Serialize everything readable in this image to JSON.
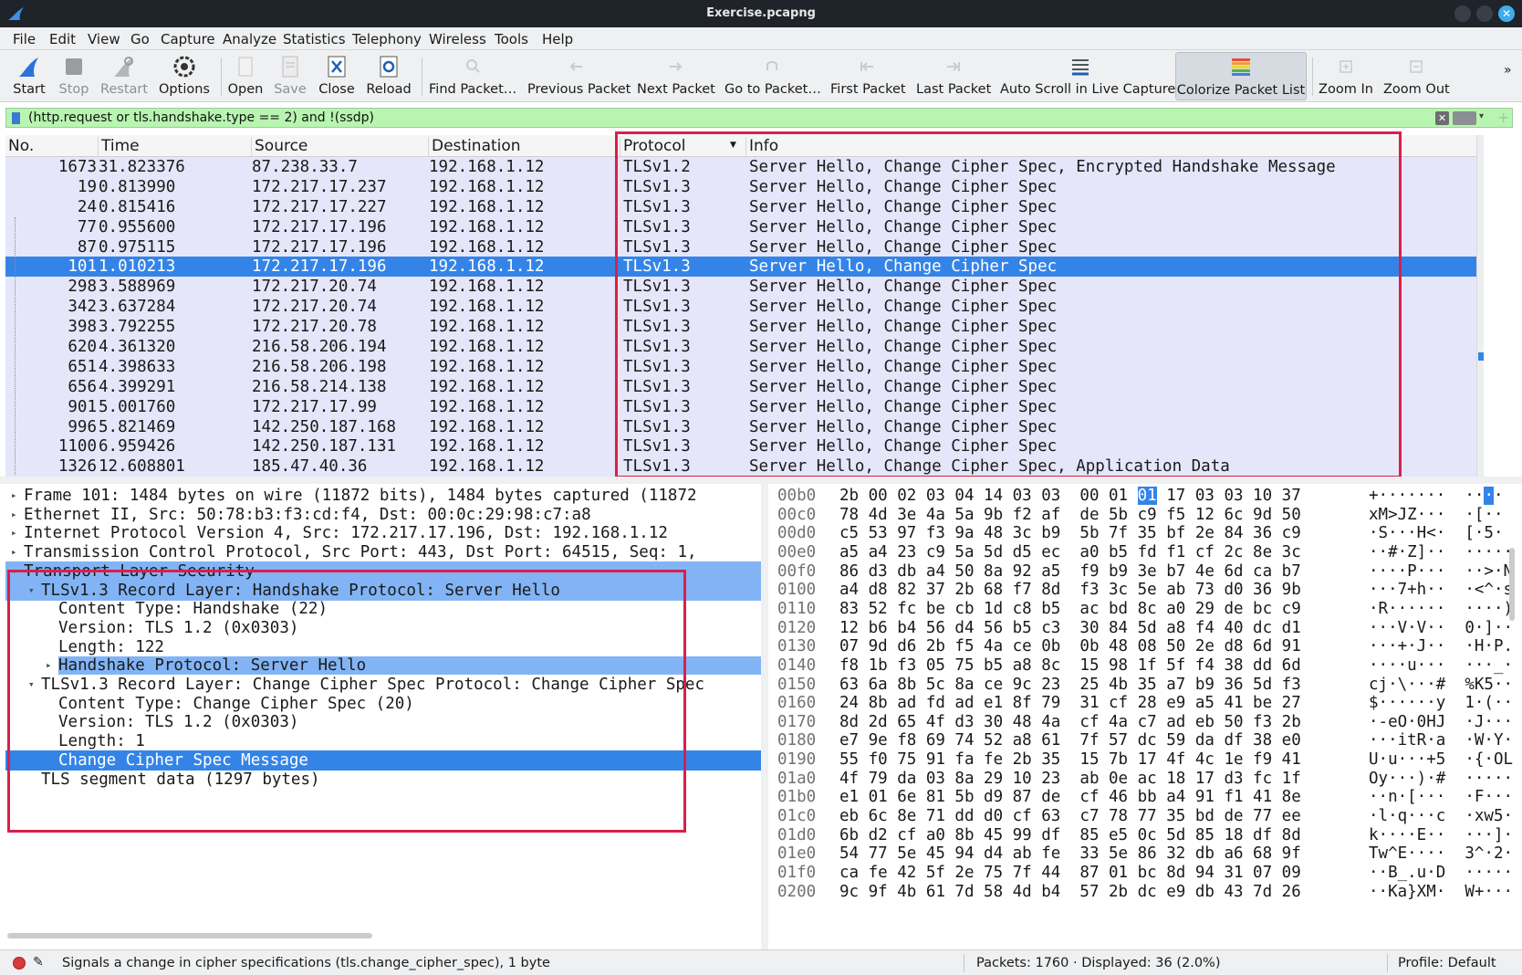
{
  "window": {
    "title": "Exercise.pcapng"
  },
  "menu": [
    "File",
    "Edit",
    "View",
    "Go",
    "Capture",
    "Analyze",
    "Statistics",
    "Telephony",
    "Wireless",
    "Tools",
    "Help"
  ],
  "toolbar": {
    "start": "Start",
    "stop": "Stop",
    "restart": "Restart",
    "options": "Options",
    "open": "Open",
    "save": "Save",
    "close": "Close",
    "reload": "Reload",
    "find_packet": "Find Packet…",
    "previous_packet": "Previous Packet",
    "next_packet": "Next Packet",
    "go_to_packet": "Go to Packet…",
    "first_packet": "First Packet",
    "last_packet": "Last Packet",
    "auto_scroll": "Auto Scroll in Live Capture",
    "colorize": "Colorize Packet List",
    "zoom_in": "Zoom In",
    "zoom_out": "Zoom Out",
    "more": "»"
  },
  "filter": {
    "value": "(http.request or tls.handshake.type == 2) and !(ssdp)"
  },
  "packet_list": {
    "columns": [
      "No.",
      "Time",
      "Source",
      "Destination",
      "Protocol",
      "Info"
    ],
    "rows": [
      {
        "no": "1673",
        "time": "31.823376",
        "source": "87.238.33.7",
        "destination": "192.168.1.12",
        "protocol": "TLSv1.2",
        "info": "Server Hello, Change Cipher Spec, Encrypted Handshake Message"
      },
      {
        "no": "19",
        "time": "0.813990",
        "source": "172.217.17.237",
        "destination": "192.168.1.12",
        "protocol": "TLSv1.3",
        "info": "Server Hello, Change Cipher Spec"
      },
      {
        "no": "24",
        "time": "0.815416",
        "source": "172.217.17.227",
        "destination": "192.168.1.12",
        "protocol": "TLSv1.3",
        "info": "Server Hello, Change Cipher Spec"
      },
      {
        "no": "77",
        "time": "0.955600",
        "source": "172.217.17.196",
        "destination": "192.168.1.12",
        "protocol": "TLSv1.3",
        "info": "Server Hello, Change Cipher Spec"
      },
      {
        "no": "87",
        "time": "0.975115",
        "source": "172.217.17.196",
        "destination": "192.168.1.12",
        "protocol": "TLSv1.3",
        "info": "Server Hello, Change Cipher Spec"
      },
      {
        "no": "101",
        "time": "1.010213",
        "source": "172.217.17.196",
        "destination": "192.168.1.12",
        "protocol": "TLSv1.3",
        "info": "Server Hello, Change Cipher Spec",
        "selected": true
      },
      {
        "no": "298",
        "time": "3.588969",
        "source": "172.217.20.74",
        "destination": "192.168.1.12",
        "protocol": "TLSv1.3",
        "info": "Server Hello, Change Cipher Spec"
      },
      {
        "no": "342",
        "time": "3.637284",
        "source": "172.217.20.74",
        "destination": "192.168.1.12",
        "protocol": "TLSv1.3",
        "info": "Server Hello, Change Cipher Spec"
      },
      {
        "no": "398",
        "time": "3.792255",
        "source": "172.217.20.78",
        "destination": "192.168.1.12",
        "protocol": "TLSv1.3",
        "info": "Server Hello, Change Cipher Spec"
      },
      {
        "no": "620",
        "time": "4.361320",
        "source": "216.58.206.194",
        "destination": "192.168.1.12",
        "protocol": "TLSv1.3",
        "info": "Server Hello, Change Cipher Spec"
      },
      {
        "no": "651",
        "time": "4.398633",
        "source": "216.58.206.198",
        "destination": "192.168.1.12",
        "protocol": "TLSv1.3",
        "info": "Server Hello, Change Cipher Spec"
      },
      {
        "no": "656",
        "time": "4.399291",
        "source": "216.58.214.138",
        "destination": "192.168.1.12",
        "protocol": "TLSv1.3",
        "info": "Server Hello, Change Cipher Spec"
      },
      {
        "no": "901",
        "time": "5.001760",
        "source": "172.217.17.99",
        "destination": "192.168.1.12",
        "protocol": "TLSv1.3",
        "info": "Server Hello, Change Cipher Spec"
      },
      {
        "no": "996",
        "time": "5.821469",
        "source": "142.250.187.168",
        "destination": "192.168.1.12",
        "protocol": "TLSv1.3",
        "info": "Server Hello, Change Cipher Spec"
      },
      {
        "no": "1100",
        "time": "6.959426",
        "source": "142.250.187.131",
        "destination": "192.168.1.12",
        "protocol": "TLSv1.3",
        "info": "Server Hello, Change Cipher Spec"
      },
      {
        "no": "1326",
        "time": "12.608801",
        "source": "185.47.40.36",
        "destination": "192.168.1.12",
        "protocol": "TLSv1.3",
        "info": "Server Hello, Change Cipher Spec, Application Data"
      }
    ]
  },
  "details": [
    {
      "text": "Frame 101: 1484 bytes on wire (11872 bits), 1484 bytes captured (11872",
      "indent": 0,
      "arrow": "right"
    },
    {
      "text": "Ethernet II, Src: 50:78:b3:f3:cd:f4, Dst: 00:0c:29:98:c7:a8",
      "indent": 0,
      "arrow": "right"
    },
    {
      "text": "Internet Protocol Version 4, Src: 172.217.17.196, Dst: 192.168.1.12",
      "indent": 0,
      "arrow": "right"
    },
    {
      "text": "Transmission Control Protocol, Src Port: 443, Dst Port: 64515, Seq: 1,",
      "indent": 0,
      "arrow": "right"
    },
    {
      "text": "Transport Layer Security",
      "indent": 0,
      "arrow": "down",
      "style": "hl"
    },
    {
      "text": "TLSv1.3 Record Layer: Handshake Protocol: Server Hello",
      "indent": 1,
      "arrow": "down",
      "style": "hl"
    },
    {
      "text": "Content Type: Handshake (22)",
      "indent": 2,
      "arrow": ""
    },
    {
      "text": "Version: TLS 1.2 (0x0303)",
      "indent": 2,
      "arrow": ""
    },
    {
      "text": "Length: 122",
      "indent": 2,
      "arrow": ""
    },
    {
      "text": "Handshake Protocol: Server Hello",
      "indent": 2,
      "arrow": "right",
      "style": "hl2"
    },
    {
      "text": "TLSv1.3 Record Layer: Change Cipher Spec Protocol: Change Cipher Spec",
      "indent": 1,
      "arrow": "down"
    },
    {
      "text": "Content Type: Change Cipher Spec (20)",
      "indent": 2,
      "arrow": ""
    },
    {
      "text": "Version: TLS 1.2 (0x0303)",
      "indent": 2,
      "arrow": ""
    },
    {
      "text": "Length: 1",
      "indent": 2,
      "arrow": ""
    },
    {
      "text": "Change Cipher Spec Message",
      "indent": 2,
      "arrow": "",
      "style": "sel"
    },
    {
      "text": "TLS segment data (1297 bytes)",
      "indent": 1,
      "arrow": ""
    }
  ],
  "hex": [
    {
      "offset": "00b0",
      "bytes1": "2b 00 02 03 04 14 03 03",
      "bytes2a": "00 01 ",
      "sel": "01",
      "bytes2b": " 17 03 03 10 37",
      "ascii_a": "+·······  ··",
      "ascii_sel": "·",
      "ascii_b": "·"
    },
    {
      "offset": "00c0",
      "bytes1": "78 4d 3e 4a 5a 9b f2 af",
      "bytes2a": "de 5b c9 f5 12 6c 9d 50",
      "ascii_a": "xM>JZ···  ·[··"
    },
    {
      "offset": "00d0",
      "bytes1": "c5 53 97 f3 9a 48 3c b9",
      "bytes2a": "5b 7f 35 bf 2e 84 36 c9",
      "ascii_a": "·S···H<·  [·5·"
    },
    {
      "offset": "00e0",
      "bytes1": "a5 a4 23 c9 5a 5d d5 ec",
      "bytes2a": "a0 b5 fd f1 cf 2c 8e 3c",
      "ascii_a": "··#·Z]··  ·····"
    },
    {
      "offset": "00f0",
      "bytes1": "86 d3 db a4 50 8a 92 a5",
      "bytes2a": "f9 b9 3e b7 4e 6d ca b7",
      "ascii_a": "····P···  ··>·N"
    },
    {
      "offset": "0100",
      "bytes1": "a4 d8 82 37 2b 68 f7 8d",
      "bytes2a": "f3 3c 5e ab 73 d0 36 9b",
      "ascii_a": "···7+h··  ·<^·s"
    },
    {
      "offset": "0110",
      "bytes1": "83 52 fc be cb 1d c8 b5",
      "bytes2a": "ac bd 8c a0 29 de bc c9",
      "ascii_a": "·R······  ····)"
    },
    {
      "offset": "0120",
      "bytes1": "12 b6 b4 56 d4 56 b5 c3",
      "bytes2a": "30 84 5d a8 f4 40 dc d1",
      "ascii_a": "···V·V··  0·]··"
    },
    {
      "offset": "0130",
      "bytes1": "07 9d d6 2b f5 4a ce 0b",
      "bytes2a": "0b 48 08 50 2e d8 6d 91",
      "ascii_a": "···+·J··  ·H·P."
    },
    {
      "offset": "0140",
      "bytes1": "f8 1b f3 05 75 b5 a8 8c",
      "bytes2a": "15 98 1f 5f f4 38 dd 6d",
      "ascii_a": "····u···  ···_·"
    },
    {
      "offset": "0150",
      "bytes1": "63 6a 8b 5c 8a ce 9c 23",
      "bytes2a": "25 4b 35 a7 b9 36 5d f3",
      "ascii_a": "cj·\\···#  %K5··"
    },
    {
      "offset": "0160",
      "bytes1": "24 8b ad fd ad e1 8f 79",
      "bytes2a": "31 cf 28 e9 a5 41 be 27",
      "ascii_a": "$······y  1·(··"
    },
    {
      "offset": "0170",
      "bytes1": "8d 2d 65 4f d3 30 48 4a",
      "bytes2a": "cf 4a c7 ad eb 50 f3 2b",
      "ascii_a": "·-eO·0HJ  ·J···"
    },
    {
      "offset": "0180",
      "bytes1": "e7 9e f8 69 74 52 a8 61",
      "bytes2a": "7f 57 dc 59 da df 38 e0",
      "ascii_a": "···itR·a  ·W·Y·"
    },
    {
      "offset": "0190",
      "bytes1": "55 f0 75 91 fa fe 2b 35",
      "bytes2a": "15 7b 17 4f 4c 1e f9 41",
      "ascii_a": "U·u···+5  ·{·OL"
    },
    {
      "offset": "01a0",
      "bytes1": "4f 79 da 03 8a 29 10 23",
      "bytes2a": "ab 0e ac 18 17 d3 fc 1f",
      "ascii_a": "Oy···)·#  ·····"
    },
    {
      "offset": "01b0",
      "bytes1": "e1 01 6e 81 5b d9 87 de",
      "bytes2a": "cf 46 bb a4 91 f1 41 8e",
      "ascii_a": "··n·[···  ·F···"
    },
    {
      "offset": "01c0",
      "bytes1": "eb 6c 8e 71 dd d0 cf 63",
      "bytes2a": "c7 78 77 35 bd de 77 ee",
      "ascii_a": "·l·q···c  ·xw5·"
    },
    {
      "offset": "01d0",
      "bytes1": "6b d2 cf a0 8b 45 99 df",
      "bytes2a": "85 e5 0c 5d 85 18 df 8d",
      "ascii_a": "k····E··  ···]·"
    },
    {
      "offset": "01e0",
      "bytes1": "54 77 5e 45 94 d4 ab fe",
      "bytes2a": "33 5e 86 32 db a6 68 9f",
      "ascii_a": "Tw^E····  3^·2·"
    },
    {
      "offset": "01f0",
      "bytes1": "ca fe 42 5f 2e 75 7f 44",
      "bytes2a": "87 01 bc 8d 94 31 07 09",
      "ascii_a": "··B_.u·D  ·····"
    },
    {
      "offset": "0200",
      "bytes1": "9c 9f 4b 61 7d 58 4d b4",
      "bytes2a": "57 2b dc e9 db 43 7d 26",
      "ascii_a": "··Ka}XM·  W+···"
    }
  ],
  "status": {
    "message": "Signals a change in cipher specifications (tls.change_cipher_spec), 1 byte",
    "packets": "Packets: 1760 · Displayed: 36 (2.0%)",
    "profile": "Profile: Default"
  }
}
